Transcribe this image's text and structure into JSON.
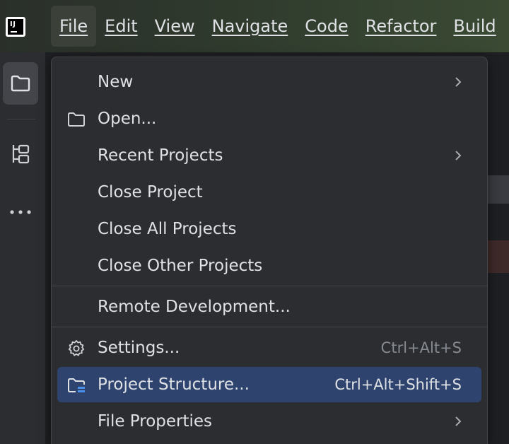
{
  "app": {
    "logo_text": "IJ"
  },
  "menubar": {
    "items": [
      {
        "label": "File"
      },
      {
        "label": "Edit"
      },
      {
        "label": "View"
      },
      {
        "label": "Navigate"
      },
      {
        "label": "Code"
      },
      {
        "label": "Refactor"
      },
      {
        "label": "Build"
      }
    ],
    "active_index": 0
  },
  "file_menu": {
    "items": [
      {
        "label": "New",
        "icon": "none",
        "shortcut": "",
        "submenu": true
      },
      {
        "label": "Open...",
        "icon": "folder-icon",
        "shortcut": "",
        "submenu": false
      },
      {
        "label": "Recent Projects",
        "icon": "none",
        "shortcut": "",
        "submenu": true
      },
      {
        "label": "Close Project",
        "icon": "none",
        "shortcut": "",
        "submenu": false
      },
      {
        "label": "Close All Projects",
        "icon": "none",
        "shortcut": "",
        "submenu": false
      },
      {
        "label": "Close Other Projects",
        "icon": "none",
        "shortcut": "",
        "submenu": false
      },
      {
        "label": "Remote Development...",
        "icon": "none",
        "shortcut": "",
        "submenu": false
      },
      {
        "label": "Settings...",
        "icon": "gear-icon",
        "shortcut": "Ctrl+Alt+S",
        "submenu": false
      },
      {
        "label": "Project Structure...",
        "icon": "project-structure-icon",
        "shortcut": "Ctrl+Alt+Shift+S",
        "submenu": false,
        "selected": true
      },
      {
        "label": "File Properties",
        "icon": "none",
        "shortcut": "",
        "submenu": true
      }
    ]
  },
  "toolstrip": {
    "icons": [
      "project-folder-icon",
      "structure-icon",
      "more-icon"
    ]
  },
  "colors": {
    "popup_bg": "#2b2d30",
    "selection": "#2e436e",
    "text": "#dfe1e5",
    "shortcut_text": "#868a91",
    "separator": "#43454a"
  }
}
